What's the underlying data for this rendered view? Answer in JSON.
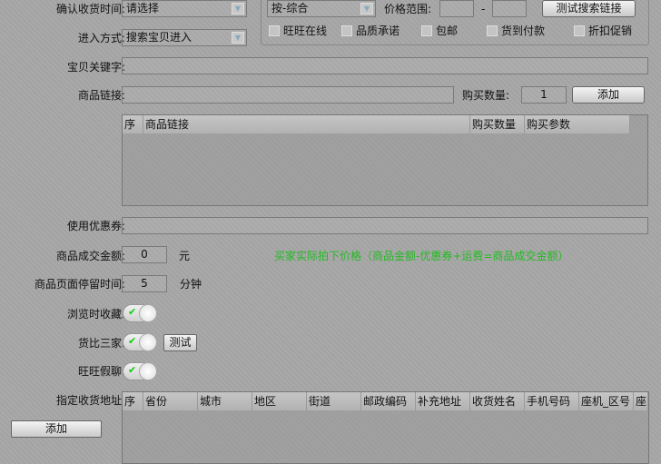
{
  "form": {
    "receive_time": {
      "label": "确认收货时间:",
      "value": "请选择"
    },
    "entry_mode": {
      "label": "进入方式:",
      "value": "搜索宝贝进入"
    },
    "keyword": {
      "label": "宝贝关键字:",
      "value": ""
    },
    "product_link": {
      "label": "商品链接:",
      "value": ""
    },
    "buy_qty": {
      "label": "购买数量:",
      "value": "1"
    },
    "add_label": "添加",
    "coupon": {
      "label": "使用优惠券:",
      "value": ""
    },
    "deal_amount": {
      "label": "商品成交金额:",
      "value": "0",
      "unit": "元",
      "note": "买家实际拍下价格（商品金额-优惠券+运费=商品成交金额）"
    },
    "stay_time": {
      "label": "商品页面停留时间:",
      "value": "5",
      "unit": "分钟"
    },
    "favorite": {
      "label": "浏览时收藏:",
      "on": true
    },
    "compare": {
      "label": "货比三家:",
      "on": true,
      "test_label": "测试"
    },
    "wangwang_chat": {
      "label": "旺旺假聊:",
      "on": true
    },
    "address": {
      "label": "指定收货地址:",
      "add_label": "添加"
    }
  },
  "search": {
    "sort": "按-综合",
    "price_label": "价格范围:",
    "price_min": "",
    "dash": "-",
    "price_max": "",
    "test_button": "测试搜索链接",
    "filters": [
      {
        "label": "旺旺在线",
        "checked": false
      },
      {
        "label": "品质承诺",
        "checked": false
      },
      {
        "label": "包邮",
        "checked": false
      },
      {
        "label": "货到付款",
        "checked": false
      },
      {
        "label": "折扣促销",
        "checked": false
      }
    ]
  },
  "link_table": {
    "columns": [
      "序",
      "商品链接",
      "购买数量",
      "购买参数"
    ]
  },
  "address_table": {
    "columns": [
      "序",
      "省份",
      "城市",
      "地区",
      "街道",
      "邮政编码",
      "补充地址",
      "收货姓名",
      "手机号码",
      "座机_区号",
      "座"
    ]
  },
  "colors": {
    "note": "#22bb22",
    "check": "#11cc11"
  }
}
